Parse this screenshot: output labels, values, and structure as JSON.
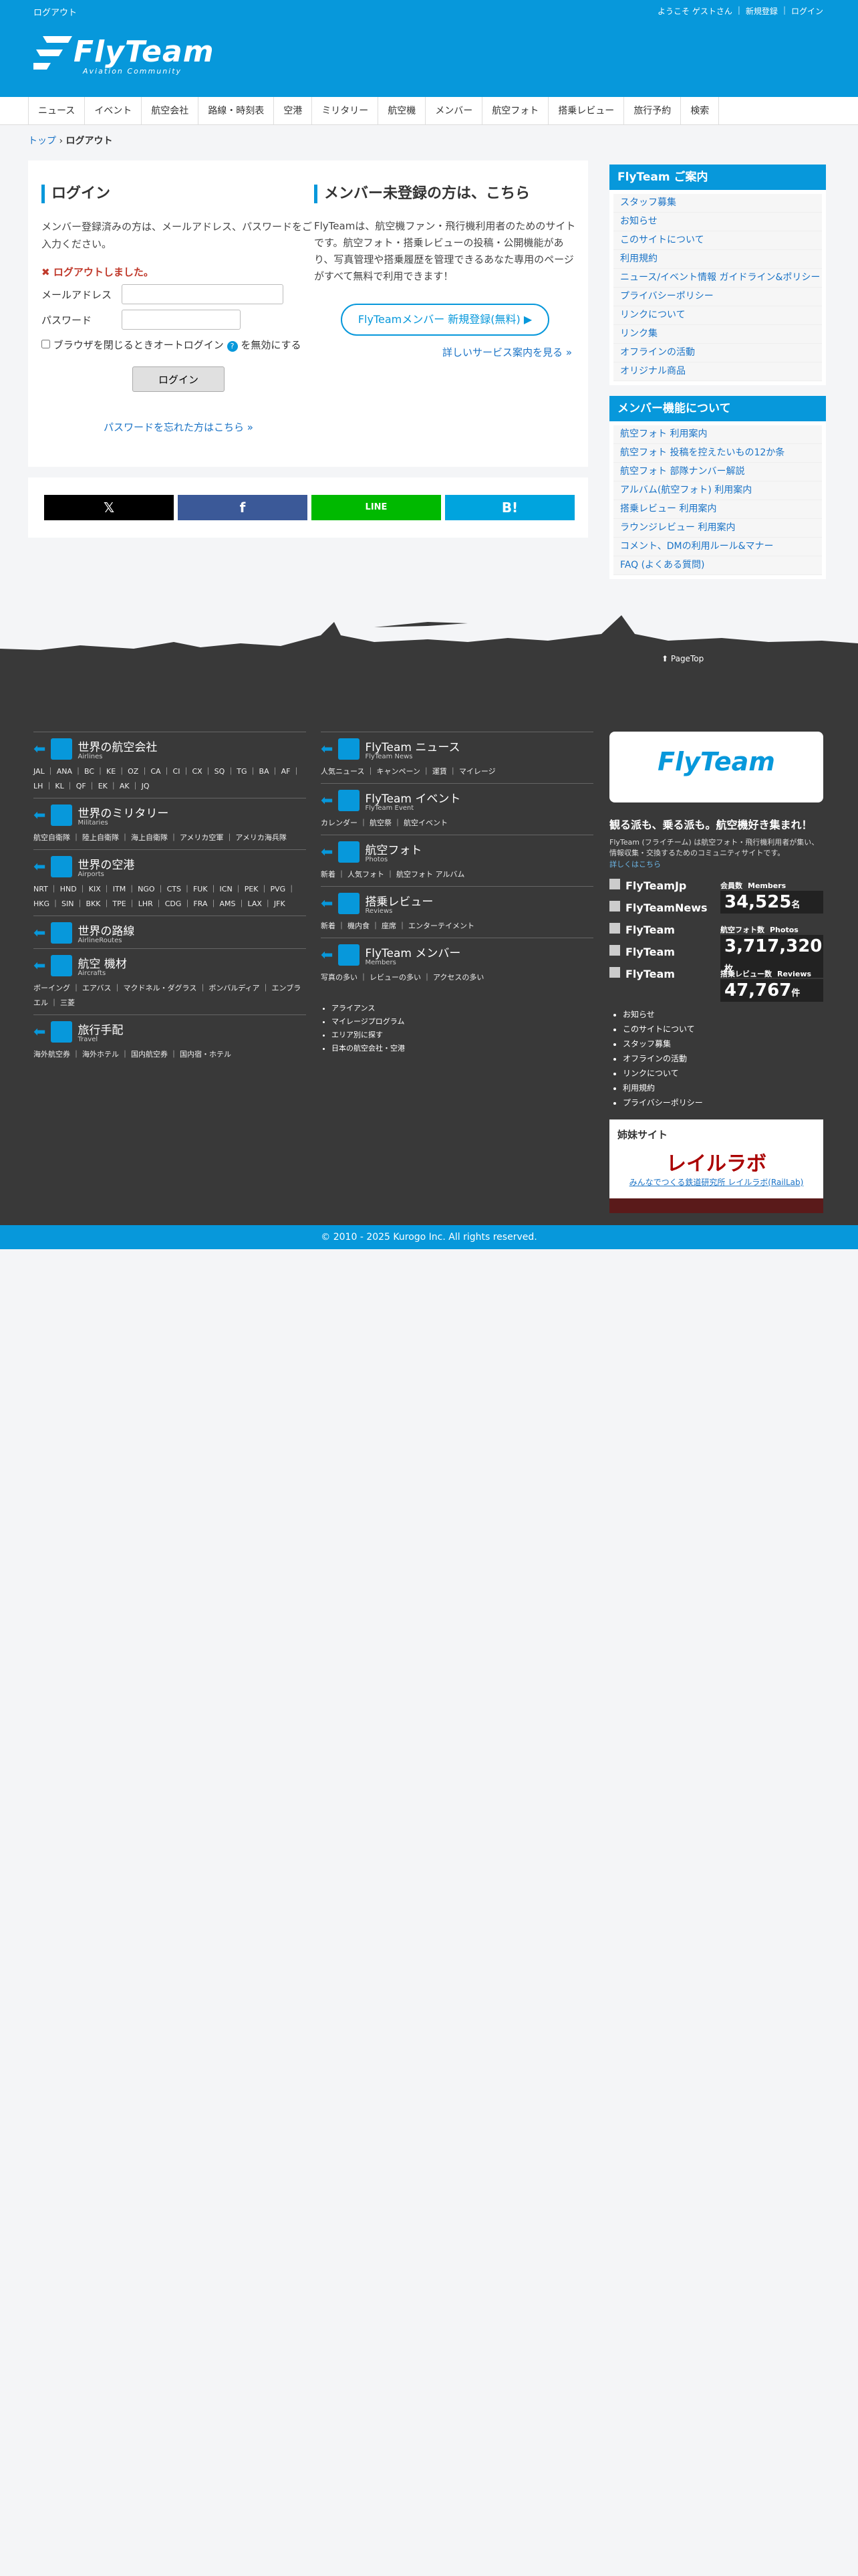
{
  "header": {
    "logout": "ログアウト",
    "welcome": "ようこそ ゲストさん",
    "signup": "新規登録",
    "login": "ログイン",
    "logo": "FlyTeam",
    "logo_sub": "Aviation Community"
  },
  "nav": [
    "ニュース",
    "イベント",
    "航空会社",
    "路線・時刻表",
    "空港",
    "ミリタリー",
    "航空機",
    "メンバー",
    "航空フォト",
    "搭乗レビュー",
    "旅行予約",
    "検索"
  ],
  "crumb": {
    "top": "トップ",
    "current": "ログアウト"
  },
  "login": {
    "title": "ログイン",
    "desc": "メンバー登録済みの方は、メールアドレス、パスワードをご入力ください。",
    "error": "ログアウトしました。",
    "email_label": "メールアドレス",
    "pass_label": "パスワード",
    "auto": "ブラウザを閉じるときオートログイン",
    "auto2": "を無効にする",
    "button": "ログイン",
    "forgot": "パスワードを忘れた方はこちら"
  },
  "register": {
    "title": "メンバー未登録の方は、こちら",
    "desc": "FlyTeamは、航空機ファン・飛行機利用者のためのサイトです。航空フォト・搭乗レビューの投稿・公開機能があり、写真管理や搭乗履歴を管理できるあなた専用のページがすべて無料で利用できます！",
    "button": "FlyTeamメンバー 新規登録(無料)",
    "more": "詳しいサービス案内を見る"
  },
  "share": [
    "𝕏",
    "f",
    "LINE",
    "B!"
  ],
  "side": {
    "guide_title": "FlyTeam ご案内",
    "guide": [
      "スタッフ募集",
      "お知らせ",
      "このサイトについて",
      "利用規約",
      "ニュース/イベント情報 ガイドライン&ポリシー",
      "プライバシーポリシー",
      "リンクについて",
      "リンク集",
      "オフラインの活動",
      "オリジナル商品"
    ],
    "member_title": "メンバー機能について",
    "member": [
      "航空フォト 利用案内",
      "航空フォト 投稿を控えたいもの12か条",
      "航空フォト 部隊ナンバー解説",
      "アルバム(航空フォト) 利用案内",
      "搭乗レビュー 利用案内",
      "ラウンジレビュー 利用案内",
      "コメント、DMの利用ルール&マナー",
      "FAQ (よくある質問)"
    ]
  },
  "footer": {
    "pagetop": "PageTop",
    "left": [
      {
        "t": "世界の航空会社",
        "s": "Airlines",
        "l": "JAL ｜ ANA ｜ BC ｜ KE ｜ OZ ｜ CA ｜ CI ｜ CX ｜ SQ ｜ TG ｜ BA ｜ AF ｜ LH ｜ KL ｜ QF ｜ EK ｜ AK ｜ JQ"
      },
      {
        "t": "世界のミリタリー",
        "s": "Militaries",
        "l": "航空自衛隊 ｜ 陸上自衛隊 ｜ 海上自衛隊 ｜ アメリカ空軍 ｜ アメリカ海兵隊"
      },
      {
        "t": "世界の空港",
        "s": "Airports",
        "l": "NRT ｜ HND ｜ KIX ｜ ITM ｜ NGO ｜ CTS ｜ FUK ｜ ICN ｜ PEK ｜ PVG ｜ HKG ｜ SIN ｜ BKK ｜ TPE ｜ LHR ｜ CDG ｜ FRA ｜ AMS ｜ LAX ｜ JFK"
      },
      {
        "t": "世界の路線",
        "s": "AirlineRoutes",
        "l": ""
      },
      {
        "t": "航空 機材",
        "s": "Aircrafts",
        "l": "ボーイング ｜ エアバス ｜ マクドネル・ダグラス ｜ ボンバルディア ｜ エンブラエル ｜ 三菱"
      },
      {
        "t": "旅行手配",
        "s": "Travel",
        "l": "海外航空券 ｜ 海外ホテル ｜ 国内航空券 ｜ 国内宿・ホテル"
      }
    ],
    "mid": [
      {
        "t": "FlyTeam ニュース",
        "s": "FlyTeam News",
        "l": "人気ニュース ｜ キャンペーン ｜ 運賃 ｜ マイレージ"
      },
      {
        "t": "FlyTeam イベント",
        "s": "FlyTeam Event",
        "l": "カレンダー ｜ 航空祭 ｜ 航空イベント"
      },
      {
        "t": "航空フォト",
        "s": "Photos",
        "l": "新着 ｜ 人気フォト ｜ 航空フォト アルバム"
      },
      {
        "t": "搭乗レビュー",
        "s": "Reviews",
        "l": "新着 ｜ 機内食 ｜ 座席 ｜ エンターテイメント"
      },
      {
        "t": "FlyTeam メンバー",
        "s": "Members",
        "l": "写真の多い ｜ レビューの多い ｜ アクセスの多い"
      }
    ],
    "mid_list": [
      "アライアンス",
      "マイレージプログラム",
      "エリア別に探す",
      "日本の航空会社・空港"
    ],
    "tagline": "観る派も、乗る派も。航空機好き集まれ！",
    "about": "FlyTeam (フライチーム) は航空フォト・飛行機利用者が集い、情報収集・交換するためのコミュニティサイトです。",
    "about_more": "詳しくはこちら",
    "social": [
      "FlyTeamJp",
      "FlyTeamNews",
      "FlyTeam",
      "FlyTeam",
      "FlyTeam"
    ],
    "stats": [
      {
        "l": "会員数",
        "s": "Members",
        "v": "34,525",
        "u": "名"
      },
      {
        "l": "航空フォト数",
        "s": "Photos",
        "v": "3,717,320",
        "u": "枚"
      },
      {
        "l": "搭乗レビュー数",
        "s": "Reviews",
        "v": "47,767",
        "u": "件"
      }
    ],
    "right_list": [
      "お知らせ",
      "このサイトについて",
      "スタッフ募集",
      "オフラインの活動",
      "リンクについて",
      "利用規約",
      "プライバシーポリシー"
    ],
    "sister": "姉妹サイト",
    "sister_name": "レイルラボ",
    "sister_link": "みんなでつくる鉄道研究所 レイルラボ(RailLab)"
  },
  "copyright": "© 2010 - 2025 Kurogo Inc. All rights reserved."
}
